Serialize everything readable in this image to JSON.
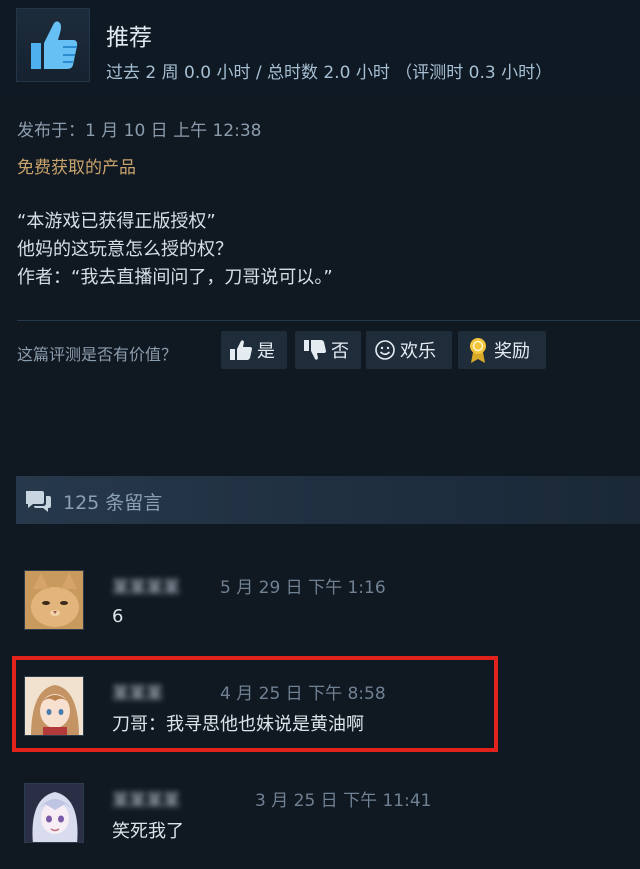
{
  "review": {
    "verdict": "推荐",
    "hours": "过去 2 周 0.0 小时 / 总时数 2.0 小时 （评测时 0.3 小时）",
    "posted": "发布于：1 月 10 日 上午 12:38",
    "free_label": "免费获取的产品",
    "body_lines": [
      "“本游戏已获得正版授权”",
      "他妈的这玩意怎么授的权？",
      "作者：“我去直播间问了，刀哥说可以。”"
    ]
  },
  "helpful": {
    "question": "这篇评测是否有价值？",
    "yes": "是",
    "no": "否",
    "funny": "欢乐",
    "award": "奖励"
  },
  "comments_header": {
    "count_label": "125 条留言"
  },
  "comments": [
    {
      "author": "某某某某",
      "time": "5 月 29 日 下午 1:16",
      "text": "6"
    },
    {
      "author": "某某某",
      "time": "4 月 25 日 下午 8:58",
      "text": "刀哥：我寻思他也妹说是黄油啊"
    },
    {
      "author": "某某某某",
      "time": "3 月 25 日 下午 11:41",
      "text": "笑死我了"
    }
  ],
  "colors": {
    "background": "#101822",
    "free_label": "#c9a36c",
    "highlight_border": "#e2221d",
    "thumb_icon": "#66c0f4"
  },
  "icons": {
    "recommend": "thumbs-up-icon",
    "comments": "speech-bubbles-icon",
    "yes": "thumbs-up-icon",
    "no": "thumbs-down-icon",
    "funny": "smiley-icon",
    "award": "award-ribbon-icon"
  }
}
